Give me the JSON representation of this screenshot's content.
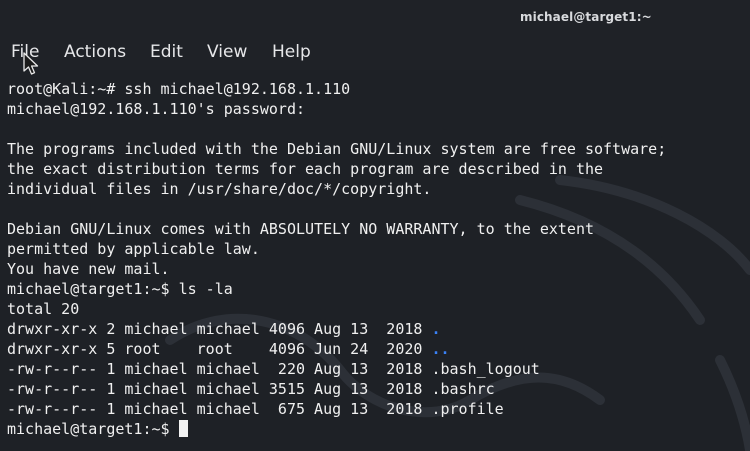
{
  "window": {
    "title": "michael@target1:~"
  },
  "menu": {
    "items": [
      "File",
      "Actions",
      "Edit",
      "View",
      "Help"
    ]
  },
  "terminal": {
    "lines": [
      "root@Kali:~# ssh michael@192.168.1.110",
      "michael@192.168.1.110's password:",
      "",
      "The programs included with the Debian GNU/Linux system are free software;",
      "the exact distribution terms for each program are described in the",
      "individual files in /usr/share/doc/*/copyright.",
      "",
      "Debian GNU/Linux comes with ABSOLUTELY NO WARRANTY, to the extent",
      "permitted by applicable law.",
      "You have new mail.",
      "michael@target1:~$ ls -la",
      "total 20"
    ],
    "listing": [
      {
        "meta": "drwxr-xr-x 2 michael michael 4096 Aug 13  2018 ",
        "name": ".",
        "is_dir": true
      },
      {
        "meta": "drwxr-xr-x 5 root    root    4096 Jun 24  2020 ",
        "name": "..",
        "is_dir": true
      },
      {
        "meta": "-rw-r--r-- 1 michael michael  220 Aug 13  2018 ",
        "name": ".bash_logout",
        "is_dir": false
      },
      {
        "meta": "-rw-r--r-- 1 michael michael 3515 Aug 13  2018 ",
        "name": ".bashrc",
        "is_dir": false
      },
      {
        "meta": "-rw-r--r-- 1 michael michael  675 Aug 13  2018 ",
        "name": ".profile",
        "is_dir": false
      }
    ],
    "prompt": "michael@target1:~$ "
  },
  "colors": {
    "background": "#1e2126",
    "text": "#f0f0f0",
    "directory": "#3a82f7"
  },
  "icons": {
    "mouse_pointer": "mouse-pointer-icon",
    "wallpaper": "kali-dragon-watermark"
  }
}
